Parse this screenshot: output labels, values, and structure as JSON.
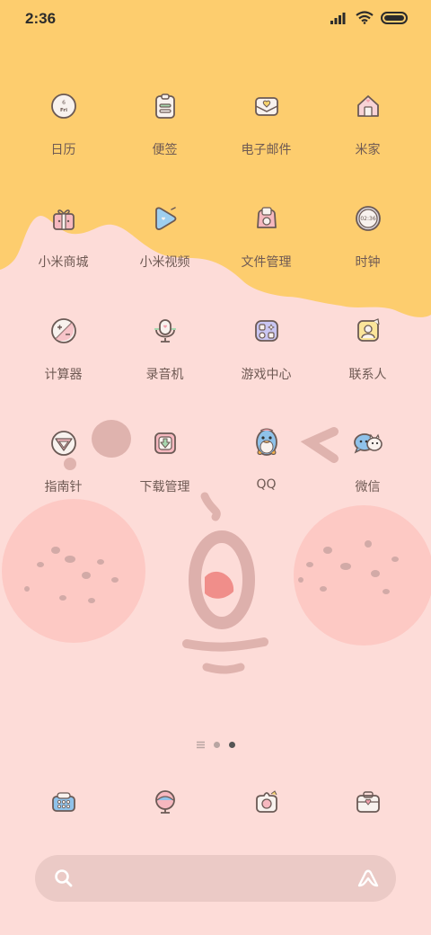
{
  "status": {
    "time": "2:36"
  },
  "apps": [
    {
      "label": "日历",
      "icon": "calendar-icon",
      "date": "6",
      "day": "Fri"
    },
    {
      "label": "便签",
      "icon": "notes-icon"
    },
    {
      "label": "电子邮件",
      "icon": "mail-icon"
    },
    {
      "label": "米家",
      "icon": "home-icon"
    },
    {
      "label": "小米商城",
      "icon": "gift-icon"
    },
    {
      "label": "小米视频",
      "icon": "video-icon"
    },
    {
      "label": "文件管理",
      "icon": "files-icon"
    },
    {
      "label": "时钟",
      "icon": "clock-icon",
      "clock_text": "02:36"
    },
    {
      "label": "计算器",
      "icon": "calculator-icon"
    },
    {
      "label": "录音机",
      "icon": "recorder-icon"
    },
    {
      "label": "游戏中心",
      "icon": "gamepad-icon"
    },
    {
      "label": "联系人",
      "icon": "contacts-icon"
    },
    {
      "label": "指南针",
      "icon": "compass-icon"
    },
    {
      "label": "下载管理",
      "icon": "download-icon"
    },
    {
      "label": "QQ",
      "icon": "qq-penguin-icon"
    },
    {
      "label": "微信",
      "icon": "wechat-icon"
    }
  ],
  "dock": [
    {
      "icon": "phone-icon"
    },
    {
      "icon": "messages-icon"
    },
    {
      "icon": "camera-icon"
    },
    {
      "icon": "toolbox-icon"
    }
  ],
  "pager": {
    "pages": 3,
    "current": 3,
    "first_is_list": true
  },
  "search": {
    "left_icon": "search-icon",
    "right_icon": "assistant-icon"
  },
  "colors": {
    "wallpaper_top": "#fdcd6e",
    "wallpaper_bottom": "#fddcd8",
    "icon_outline": "#6b5a55"
  }
}
